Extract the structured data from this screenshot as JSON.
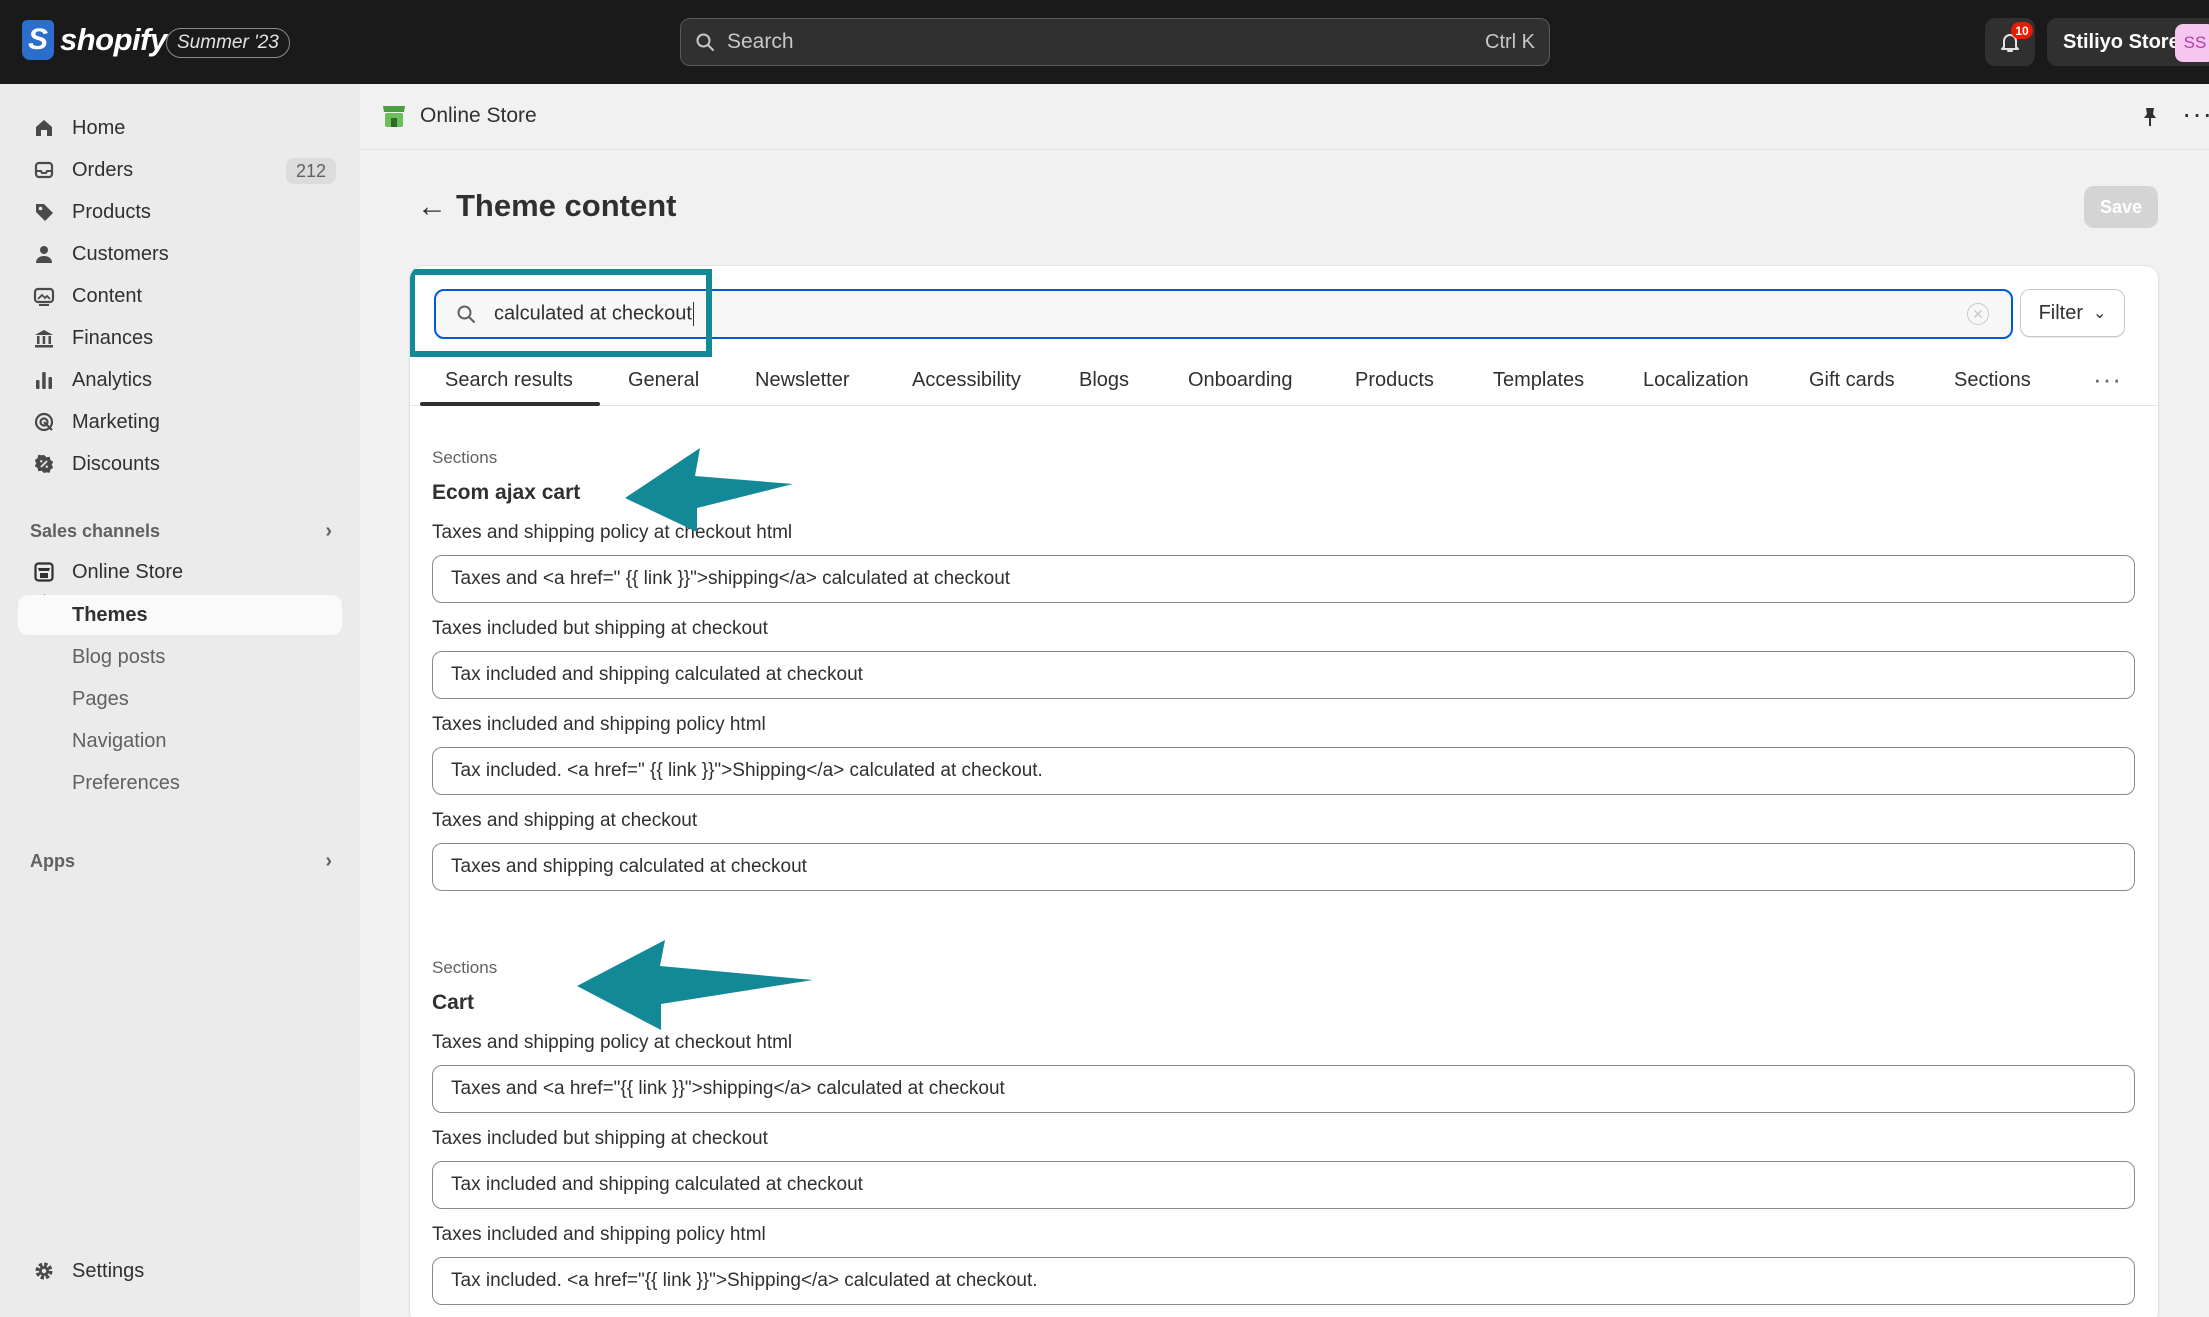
{
  "topbar": {
    "brand": "shopify",
    "brand_initial": "S",
    "edition_badge": "Summer '23",
    "search_placeholder": "Search",
    "search_shortcut": "Ctrl K",
    "notification_count": "10",
    "store_name": "Stiliyo Store",
    "avatar_initials": "SS"
  },
  "sidebar": {
    "items": [
      {
        "label": "Home",
        "icon": "home-icon"
      },
      {
        "label": "Orders",
        "icon": "inbox-icon",
        "count": "212"
      },
      {
        "label": "Products",
        "icon": "tag-icon"
      },
      {
        "label": "Customers",
        "icon": "person-icon"
      },
      {
        "label": "Content",
        "icon": "content-icon"
      },
      {
        "label": "Finances",
        "icon": "bank-icon"
      },
      {
        "label": "Analytics",
        "icon": "bar-chart-icon"
      },
      {
        "label": "Marketing",
        "icon": "target-icon"
      },
      {
        "label": "Discounts",
        "icon": "discount-icon"
      }
    ],
    "sales_channels_label": "Sales channels",
    "online_store_label": "Online Store",
    "sub_items": [
      "Themes",
      "Blog posts",
      "Pages",
      "Navigation",
      "Preferences"
    ],
    "apps_label": "Apps",
    "settings_label": "Settings"
  },
  "appbar": {
    "title": "Online Store"
  },
  "page": {
    "title": "Theme content",
    "save_label": "Save"
  },
  "search": {
    "value": "calculated at checkout",
    "filter_label": "Filter"
  },
  "tabs": [
    "Search results",
    "General",
    "Newsletter",
    "Accessibility",
    "Blogs",
    "Onboarding",
    "Products",
    "Templates",
    "Localization",
    "Gift cards",
    "Sections"
  ],
  "groups": [
    {
      "label": "Sections",
      "title": "Ecom ajax cart",
      "fields": [
        {
          "label": "Taxes and shipping policy at checkout html",
          "value": "Taxes and <a href=\" {{ link }}\">shipping</a> calculated at checkout"
        },
        {
          "label": "Taxes included but shipping at checkout",
          "value": "Tax included and shipping calculated at checkout"
        },
        {
          "label": "Taxes included and shipping policy html",
          "value": "Tax included. <a href=\" {{ link }}\">Shipping</a> calculated at checkout."
        },
        {
          "label": "Taxes and shipping at checkout",
          "value": "Taxes and shipping calculated at checkout"
        }
      ]
    },
    {
      "label": "Sections",
      "title": "Cart",
      "fields": [
        {
          "label": "Taxes and shipping policy at checkout html",
          "value": "Taxes and <a href=\"{{ link }}\">shipping</a> calculated at checkout"
        },
        {
          "label": "Taxes included but shipping at checkout",
          "value": "Tax included and shipping calculated at checkout"
        },
        {
          "label": "Taxes included and shipping policy html",
          "value": "Tax included. <a href=\"{{ link }}\">Shipping</a> calculated at checkout."
        }
      ]
    }
  ],
  "colors": {
    "topbar": "#1a1a1a",
    "focus_blue": "#005bd3",
    "annotation_teal": "#138896",
    "notification_red": "#e51c00"
  }
}
